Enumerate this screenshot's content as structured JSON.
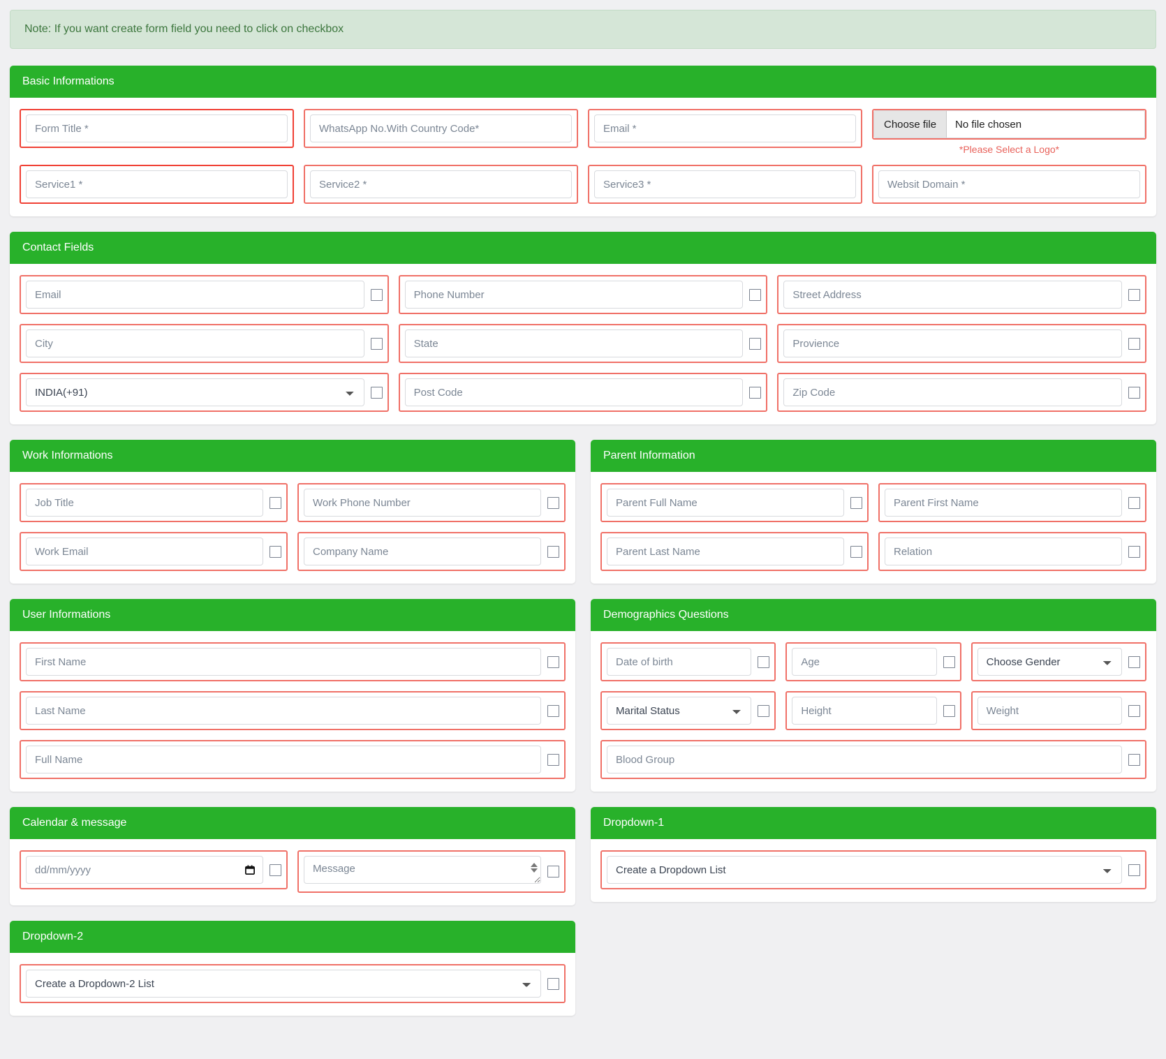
{
  "note": "Note: If you want create form field you need to click on checkbox",
  "basic": {
    "title": "Basic Informations",
    "form_title_placeholder": "Form Title *",
    "whatsapp_placeholder": "WhatsApp No.With Country Code*",
    "email_placeholder": "Email *",
    "file_button_label": "Choose file",
    "file_status": "No file chosen",
    "logo_note": "*Please Select a Logo*",
    "service1_placeholder": "Service1 *",
    "service2_placeholder": "Service2 *",
    "service3_placeholder": "Service3 *",
    "website_placeholder": "Websit Domain *"
  },
  "contact": {
    "title": "Contact Fields",
    "email_placeholder": "Email",
    "phone_placeholder": "Phone Number",
    "street_placeholder": "Street Address",
    "city_placeholder": "City",
    "state_placeholder": "State",
    "province_placeholder": "Provience",
    "country_selected": "INDIA(+91)",
    "postcode_placeholder": "Post Code",
    "zipcode_placeholder": "Zip Code"
  },
  "work": {
    "title": "Work Informations",
    "job_title_placeholder": "Job Title",
    "work_phone_placeholder": "Work Phone Number",
    "work_email_placeholder": "Work Email",
    "company_placeholder": "Company Name"
  },
  "parent": {
    "title": "Parent Information",
    "full_name_placeholder": "Parent Full Name",
    "first_name_placeholder": "Parent First Name",
    "last_name_placeholder": "Parent Last Name",
    "relation_placeholder": "Relation"
  },
  "user": {
    "title": "User Informations",
    "first_name_placeholder": "First Name",
    "last_name_placeholder": "Last Name",
    "full_name_placeholder": "Full Name"
  },
  "demographics": {
    "title": "Demographics Questions",
    "dob_placeholder": "Date of birth",
    "age_placeholder": "Age",
    "gender_selected": "Choose Gender",
    "marital_selected": "Marital Status",
    "height_placeholder": "Height",
    "weight_placeholder": "Weight",
    "blood_group_placeholder": "Blood Group"
  },
  "calendar": {
    "title": "Calendar & message",
    "date_placeholder": "dd/mm/yyyy",
    "message_placeholder": "Message"
  },
  "dropdown1": {
    "title": "Dropdown-1",
    "selected": "Create a Dropdown List"
  },
  "dropdown2": {
    "title": "Dropdown-2",
    "selected": "Create a Dropdown-2 List"
  },
  "colors": {
    "header_green": "#28b12a",
    "highlight_red": "#f07067",
    "note_text_green": "#3c763d"
  }
}
